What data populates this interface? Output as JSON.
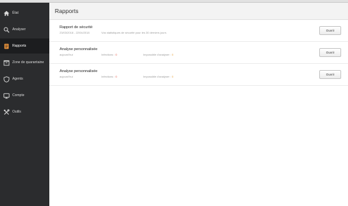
{
  "sidebar": {
    "items": [
      {
        "label": "État",
        "icon": "home-icon"
      },
      {
        "label": "Analyser",
        "icon": "search-icon"
      },
      {
        "label": "Rapports",
        "icon": "report-icon",
        "active": true
      },
      {
        "label": "Zone de quarantaine",
        "icon": "quarantine-icon"
      },
      {
        "label": "Agents",
        "icon": "shield-icon"
      },
      {
        "label": "Compte",
        "icon": "account-icon"
      },
      {
        "label": "Outils",
        "icon": "tools-icon"
      }
    ]
  },
  "header": {
    "title": "Rapports"
  },
  "reports": [
    {
      "title": "Rapport de sécurité",
      "date": "23/03/2018 - 22/04/2018",
      "description": "Vos statistiques de sécurité pour les 30 derniers jours",
      "button": "Ouvrir"
    },
    {
      "title": "Analyse personnalisée",
      "date": "aujourd'hui",
      "infections_label": "Infections :",
      "infections_value": "0",
      "unscanned_label": "Impossible d'analyser :",
      "unscanned_value": "0",
      "button": "Ouvrir"
    },
    {
      "title": "Analyse personnalisée",
      "date": "aujourd'hui",
      "infections_label": "Infections :",
      "infections_value": "0",
      "unscanned_label": "Impossible d'analyser :",
      "unscanned_value": "0",
      "button": "Ouvrir"
    }
  ],
  "colors": {
    "sidebar_bg": "#2b2c2e",
    "sidebar_active_bg": "#1c1d1f",
    "active_icon": "#e8923b",
    "infections": "#e24b3b",
    "unscanned": "#e8a23b"
  }
}
